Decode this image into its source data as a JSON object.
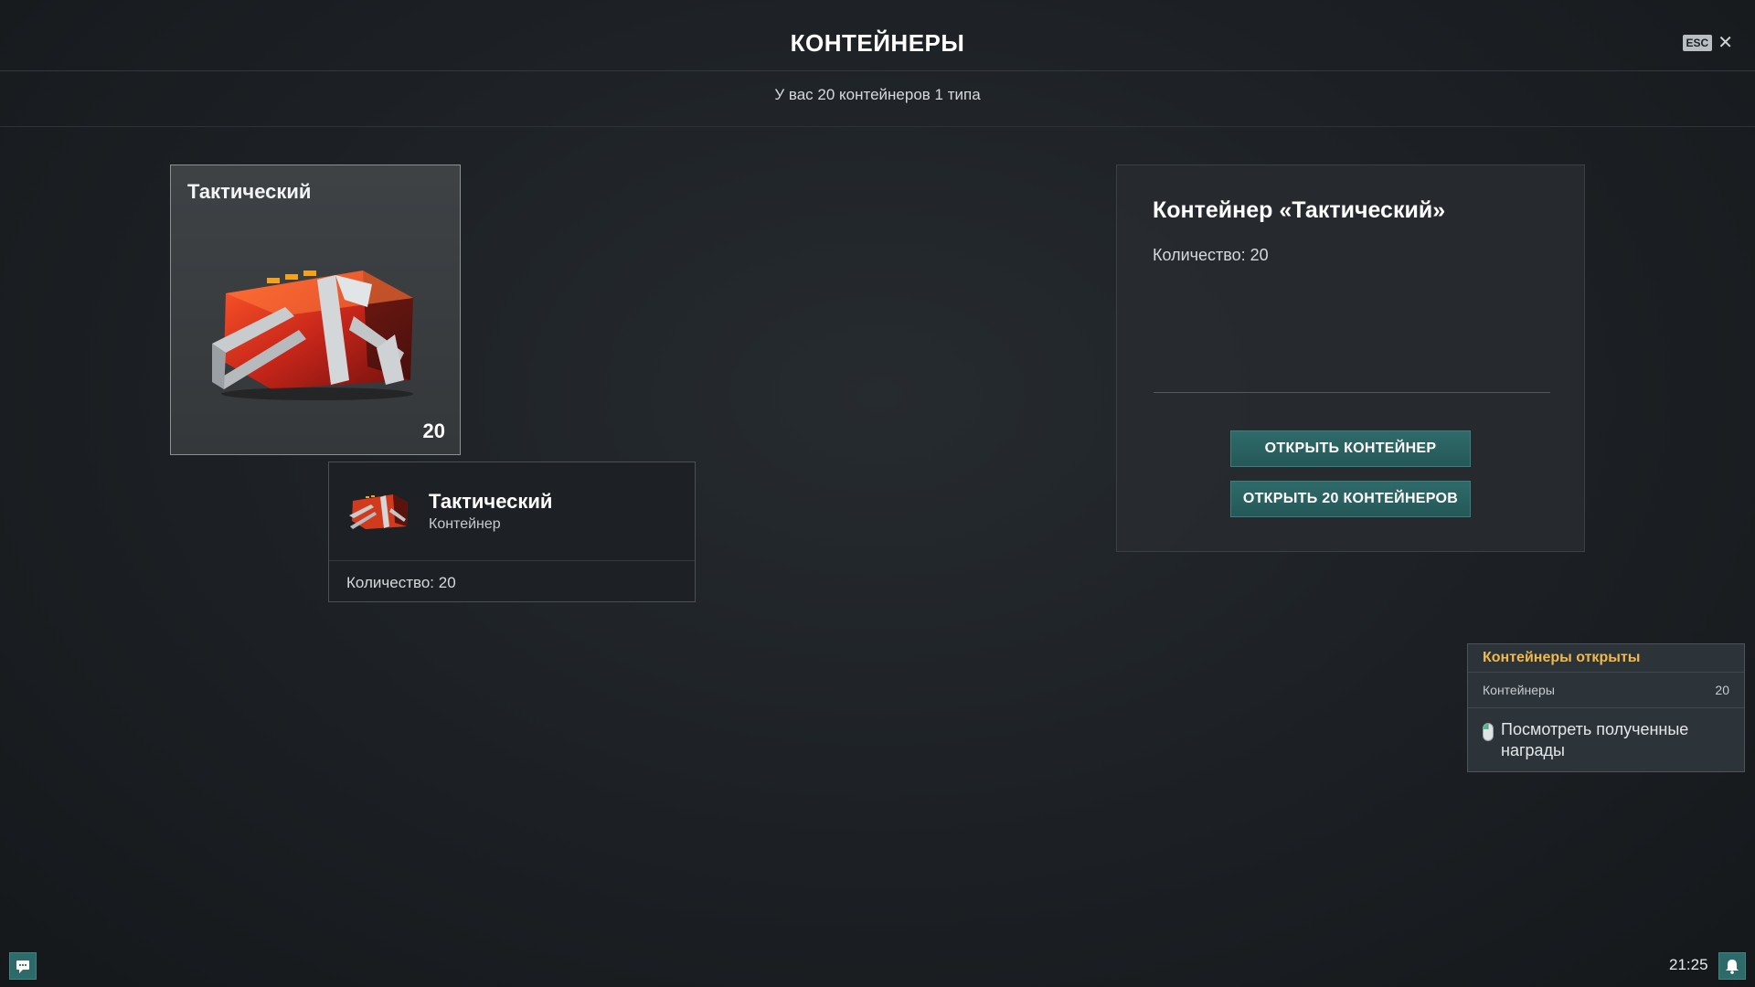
{
  "header": {
    "title": "КОНТЕЙНЕРЫ",
    "esc_label": "ESC",
    "close_glyph": "✕"
  },
  "summary": "У вас 20 контейнеров 1 типа",
  "container_card": {
    "name": "Тактический",
    "count": "20",
    "image_icon": "tactical-container-image"
  },
  "tooltip": {
    "name": "Тактический",
    "type": "Контейнер",
    "quantity_label": "Количество:",
    "quantity_value": "20"
  },
  "details": {
    "title": "Контейнер «Тактический»",
    "quantity": "Количество: 20",
    "open_one": "ОТКРЫТЬ КОНТЕЙНЕР",
    "open_all": "ОТКРЫТЬ 20 КОНТЕЙНЕРОВ"
  },
  "notification": {
    "title": "Контейнеры открыты",
    "row_label": "Контейнеры",
    "row_value": "20",
    "link_text": "Посмотреть полученные награды",
    "link_icon": "mouse-icon"
  },
  "footer": {
    "time": "21:25",
    "chat_icon": "chat-icon",
    "bell_icon": "bell-icon"
  },
  "colors": {
    "accent_teal": "#2f6a6a",
    "notify_title": "#f0b94a",
    "container_red": "#d83a1c"
  }
}
